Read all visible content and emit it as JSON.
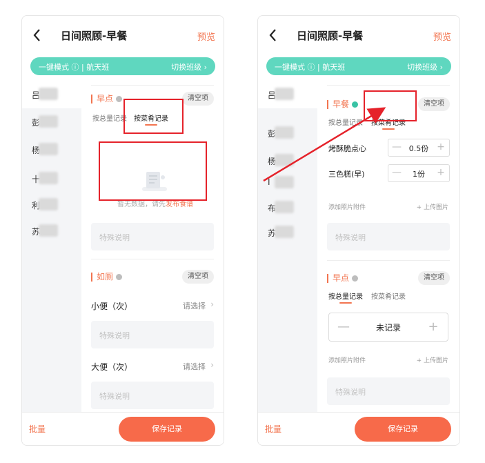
{
  "header": {
    "title": "日间照顾-早餐",
    "preview": "预览"
  },
  "banner": {
    "left": "一键模式 ⓘ | 航天班",
    "right": "切换班级 ›"
  },
  "sidebar": {
    "left_items": [
      {
        "char": "吕"
      },
      {
        "char": "彭"
      },
      {
        "char": "杨"
      },
      {
        "char": "十"
      },
      {
        "char": "利"
      },
      {
        "char": "苏"
      }
    ],
    "right_items": [
      {
        "char": "吕"
      },
      {
        "char": "彭"
      },
      {
        "char": "杨"
      },
      {
        "char": "Ⅰ"
      },
      {
        "char": "布"
      },
      {
        "char": "苏"
      }
    ]
  },
  "left": {
    "snack_title": "早点",
    "clear_label": "清空项",
    "tab_total": "按总量记录",
    "tab_dish": "按菜肴记录",
    "empty_text": "暂无数据，请先",
    "empty_link": "发布食谱",
    "special_note_placeholder": "特殊说明",
    "toilet_title": "如厕",
    "urine_label": "小便（次）",
    "stool_label": "大便（次）",
    "select_placeholder": "请选择",
    "chevron": "›"
  },
  "right": {
    "breakfast_title": "早餐",
    "clear_label": "清空项",
    "tab_total": "按总量记录",
    "tab_dish": "按菜肴记录",
    "dishes": [
      {
        "name": "烤酥脆点心",
        "value": "0.5份"
      },
      {
        "name": "三色糕(早)",
        "value": "1份"
      }
    ],
    "attach_label": "添加照片附件",
    "upload_label": "+ 上传图片",
    "special_note_placeholder": "特殊说明",
    "snack_title": "早点",
    "snack_value": "未记录",
    "minus": "—",
    "plus": "+"
  },
  "footer": {
    "batch": "批量",
    "save": "保存记录"
  },
  "colors": {
    "accent": "#f2744f",
    "banner": "#5fd7bf",
    "annotation": "#e5222a",
    "save": "#f76a4a"
  },
  "icons": {
    "back": "chevron-left-icon",
    "info": "info-circle-icon",
    "check": "check-circle-icon",
    "empty": "empty-document-icon"
  }
}
